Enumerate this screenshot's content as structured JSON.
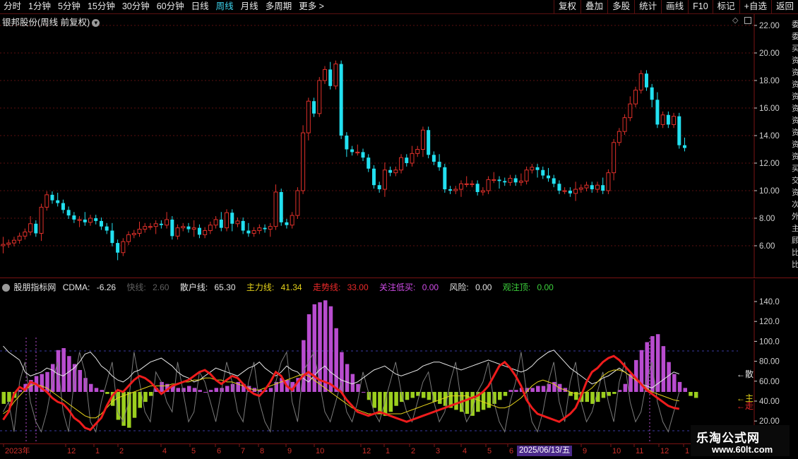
{
  "toolbar": {
    "periods": [
      "分时",
      "1分钟",
      "5分钟",
      "15分钟",
      "30分钟",
      "60分钟",
      "日线",
      "周线",
      "月线",
      "多周期",
      "更多 >"
    ],
    "active_period": "周线",
    "right_buttons": [
      "复权",
      "叠加",
      "多股",
      "统计",
      "画线",
      "F10",
      "标记",
      "+自选",
      "返回"
    ]
  },
  "main_chart": {
    "title": "银邦股份(周线 前复权)",
    "y_ticks": [
      "22.00",
      "20.00",
      "18.00",
      "16.00",
      "14.00",
      "12.00",
      "10.00",
      "8.00",
      "6.00"
    ],
    "up_color": "#e0302a",
    "down_color": "#22e0f0"
  },
  "indicator": {
    "name": "股朋指标网",
    "cdma_label": "CDMA:",
    "cdma_value": "-6.26",
    "fast_label": "快线:",
    "fast_value": "2.60",
    "retail_label": "散户线:",
    "retail_value": "65.30",
    "main_label": "主力线:",
    "main_value": "41.34",
    "trend_label": "走势线:",
    "trend_value": "33.00",
    "low_buy_label": "关注低买:",
    "low_buy_value": "0.00",
    "risk_label": "风险:",
    "risk_value": "0.00",
    "top_label": "观注顶:",
    "top_value": "0.00",
    "y_ticks": [
      "140.0",
      "120.0",
      "100.0",
      "80.00",
      "60.00",
      "40.00",
      "20.00"
    ],
    "line_labels": [
      "←散",
      "←主",
      "←走"
    ]
  },
  "time_axis": {
    "labels": [
      "2023年",
      "12",
      "1",
      "2",
      "4",
      "5",
      "6",
      "7",
      "8",
      "9",
      "10",
      "12",
      "1",
      "2",
      "3",
      "4",
      "5",
      "6",
      "9",
      "10",
      "11",
      "12",
      "1"
    ],
    "selected_date": "2025/06/13/五"
  },
  "right_edge_text": [
    "委",
    "委",
    "买",
    "资",
    "资",
    "资",
    "资",
    "资",
    "资",
    "资",
    "资",
    "资",
    "买",
    "交",
    "资",
    "次",
    "外",
    "主",
    "顾",
    "比",
    "比"
  ],
  "watermark": {
    "line1": "乐淘公式网",
    "line2": "www.60lt.com"
  },
  "colors": {
    "grid": "#5a1010",
    "purple": "#b84ccf",
    "green": "#9ccf1e",
    "trend": "#ee1c1c",
    "retail": "#e8e8e8",
    "main": "#e6d21a"
  }
}
